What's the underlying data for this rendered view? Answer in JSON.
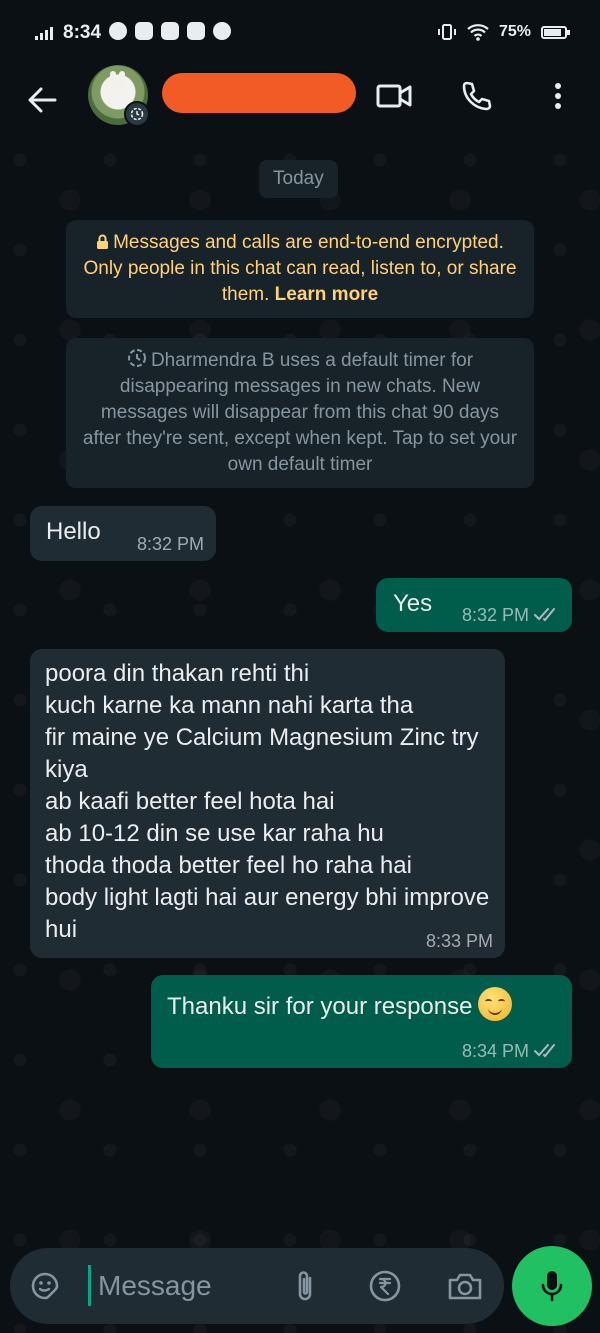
{
  "status_bar": {
    "time": "8:34",
    "battery": "75%"
  },
  "header": {
    "back_icon": "arrow-left-icon",
    "video_icon": "video-camera-icon",
    "call_icon": "phone-icon",
    "menu_icon": "more-vertical-icon"
  },
  "chat": {
    "date_chip": "Today",
    "encryption_notice": {
      "text": "Messages and calls are end-to-end encrypted. Only people in this chat can read, listen to, or share them.",
      "link": "Learn more"
    },
    "timer_notice": "Dharmendra B uses a default timer for disappearing messages in new chats. New messages will disappear from this chat 90 days after they're sent, except when kept. Tap to set your own default timer",
    "messages": [
      {
        "direction": "in",
        "text": "Hello",
        "time": "8:32 PM"
      },
      {
        "direction": "out",
        "text": "Yes",
        "time": "8:32 PM",
        "status": "read"
      },
      {
        "direction": "in",
        "text": "poora din thakan rehti thi\nkuch karne ka mann nahi karta tha\nfir maine ye Calcium Magnesium Zinc try kiya\nab kaafi better feel hota hai\nab 10-12 din se use kar raha hu\nthoda thoda better feel ho raha hai\nbody light lagti hai aur energy bhi improve hui",
        "time": "8:33 PM"
      },
      {
        "direction": "out",
        "text": "Thanku sir for your response",
        "time": "8:34 PM",
        "status": "read",
        "emoji": "smiling-face-icon"
      }
    ]
  },
  "composer": {
    "placeholder": "Message",
    "emoji_icon": "sticker-icon",
    "attach_icon": "paperclip-icon",
    "payment_icon": "rupee-icon",
    "camera_icon": "camera-icon",
    "mic_icon": "microphone-icon"
  },
  "colors": {
    "background": "#0b1014",
    "incoming_bubble": "#202c33",
    "outgoing_bubble": "#005c4b",
    "accent": "#21c063",
    "encryption_text": "#ffd279"
  }
}
